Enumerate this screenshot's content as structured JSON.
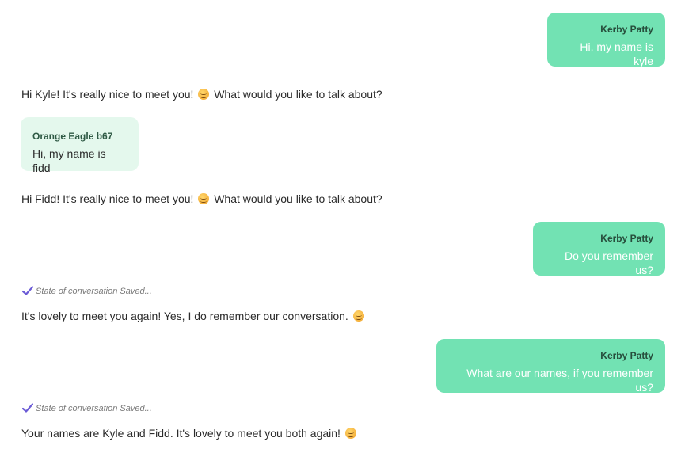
{
  "messages": [
    {
      "type": "self",
      "author": "Kerby Patty",
      "text": "Hi, my name is kyle"
    },
    {
      "type": "reply",
      "text_before": "Hi Kyle! It's really nice to meet you!",
      "emoji": "smiling-face-icon",
      "text_after": "What would you like to talk about?"
    },
    {
      "type": "other",
      "author": "Orange Eagle b67",
      "text": "Hi, my name is fidd"
    },
    {
      "type": "reply",
      "text_before": "Hi Fidd! It's really nice to meet you!",
      "emoji": "smiling-face-icon",
      "text_after": "What would you like to talk about?"
    },
    {
      "type": "self",
      "author": "Kerby Patty",
      "text": "Do you remember us?"
    },
    {
      "type": "status",
      "icon": "checkmark-icon",
      "text": "State of conversation Saved..."
    },
    {
      "type": "reply",
      "text_before": "It's lovely to meet you again! Yes, I do remember our conversation.",
      "emoji": "smiling-face-icon",
      "text_after": ""
    },
    {
      "type": "self",
      "author": "Kerby Patty",
      "text": "What are our names, if you remember us?"
    },
    {
      "type": "status",
      "icon": "checkmark-icon",
      "text": "State of conversation Saved..."
    },
    {
      "type": "reply",
      "text_before": "Your names are Kyle and Fidd. It's lovely to meet you both again!",
      "emoji": "smiling-face-icon",
      "text_after": ""
    }
  ],
  "colors": {
    "self_bubble": "#72e2b3",
    "other_bubble": "#e4f8ed",
    "check_accent": "#6b5bd6"
  }
}
